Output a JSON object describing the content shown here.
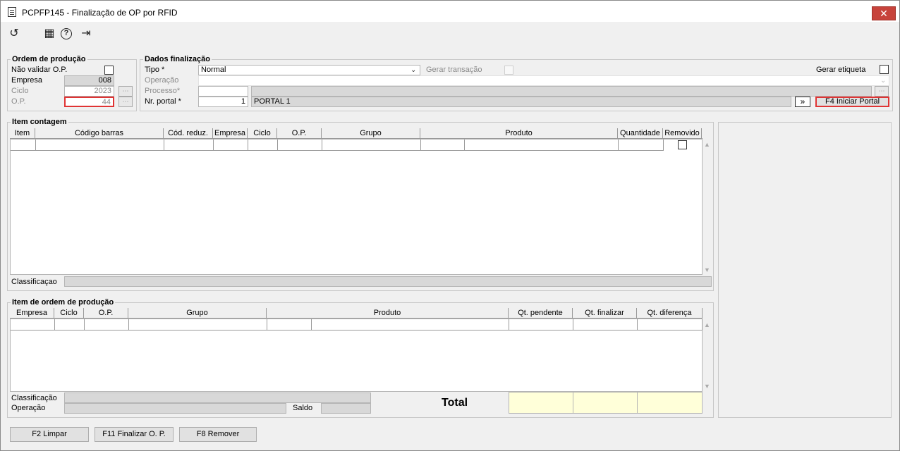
{
  "window": {
    "title": "PCPFP145 - Finalização de OP por RFID",
    "close_glyph": "✕"
  },
  "toolbar": {
    "undo_glyph": "↺",
    "calendar_glyph": "▦",
    "help_glyph": "?",
    "exit_glyph": "⇥"
  },
  "ordem": {
    "title": "Ordem de produção",
    "nao_validar_label": "Não validar O.P.",
    "empresa_label": "Empresa",
    "empresa_value": "008",
    "ciclo_label": "Ciclo",
    "ciclo_value": "2023",
    "op_label": "O.P.",
    "op_value": "44"
  },
  "dados": {
    "title": "Dados finalização",
    "tipo_label": "Tipo *",
    "tipo_value": "Normal",
    "gerar_transacao_label": "Gerar transação",
    "gerar_etiqueta_label": "Gerar etiqueta",
    "operacao_label": "Operação",
    "processo_label": "Processo*",
    "nr_portal_label": "Nr. portal *",
    "nr_portal_value": "1",
    "portal_name": "PORTAL 1",
    "forward_glyph": "»",
    "iniciar_portal_label": "F4 Iniciar Portal"
  },
  "item_contagem": {
    "title": "Item contagem",
    "columns": [
      "Item",
      "Código barras",
      "Cód. reduz.",
      "Empresa",
      "Ciclo",
      "O.P.",
      "Grupo",
      "Produto",
      "Quantidade",
      "Removido"
    ],
    "classificacao_label": "Classificaçao"
  },
  "item_ordem": {
    "title": "Item de ordem de produção",
    "columns": [
      "Empresa",
      "Ciclo",
      "O.P.",
      "Grupo",
      "Produto",
      "Qt. pendente",
      "Qt. finalizar",
      "Qt. diferença"
    ],
    "classificacao_label": "Classificação",
    "operacao_label": "Operação",
    "saldo_label": "Saldo",
    "total_label": "Total"
  },
  "buttons": {
    "limpar": "F2 Limpar",
    "finalizar": "F11 Finalizar O. P.",
    "remover": "F8 Remover"
  },
  "scroll": {
    "up": "▲",
    "down": "▼"
  }
}
